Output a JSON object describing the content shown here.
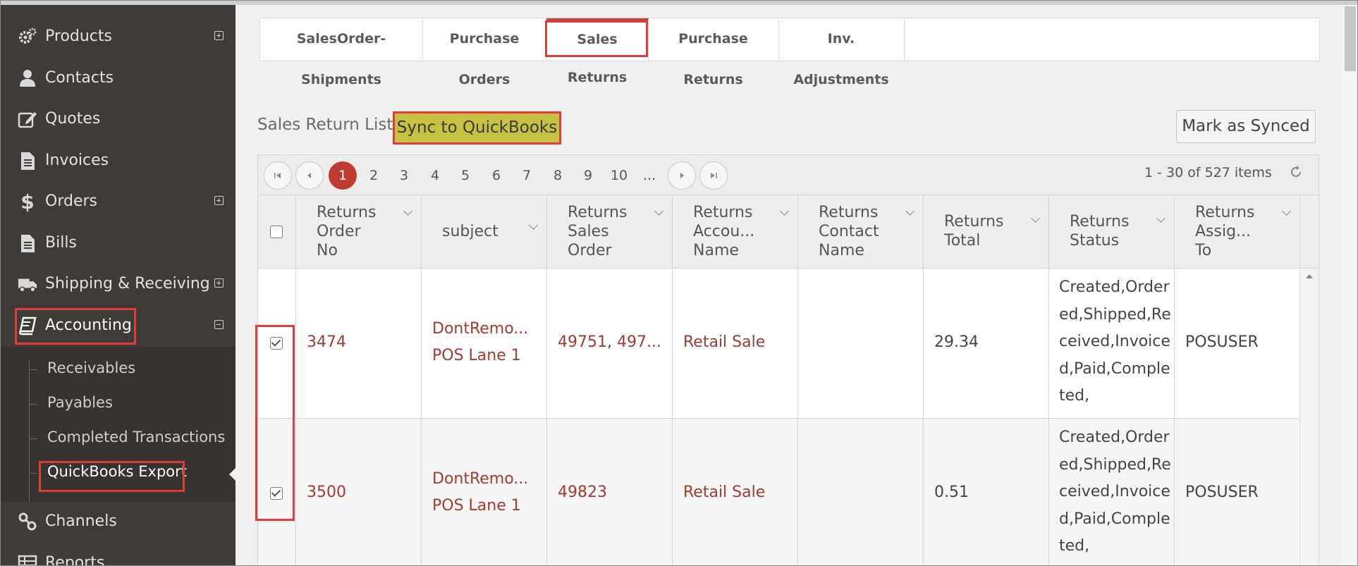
{
  "sidebar": {
    "items": [
      {
        "label": "Products",
        "icon": "gears-icon",
        "expand": "plus"
      },
      {
        "label": "Contacts",
        "icon": "user-icon",
        "expand": ""
      },
      {
        "label": "Quotes",
        "icon": "edit-icon",
        "expand": ""
      },
      {
        "label": "Invoices",
        "icon": "file-text-icon",
        "expand": ""
      },
      {
        "label": "Orders",
        "icon": "dollar-icon",
        "expand": "plus"
      },
      {
        "label": "Bills",
        "icon": "file-icon",
        "expand": ""
      },
      {
        "label": "Shipping & Receiving",
        "icon": "truck-icon",
        "expand": "plus"
      },
      {
        "label": "Accounting",
        "icon": "book-icon",
        "expand": "minus"
      },
      {
        "label": "Channels",
        "icon": "link-icon",
        "expand": ""
      },
      {
        "label": "Reports",
        "icon": "table-icon",
        "expand": ""
      }
    ],
    "accounting_sub": [
      {
        "label": "Receivables"
      },
      {
        "label": "Payables"
      },
      {
        "label": "Completed Transactions"
      },
      {
        "label": "QuickBooks Export"
      }
    ]
  },
  "tabs": [
    {
      "label": "SalesOrder-Shipments"
    },
    {
      "label": "Purchase Orders"
    },
    {
      "label": "Sales Returns"
    },
    {
      "label": "Purchase Returns"
    },
    {
      "label": "Inv. Adjustments"
    }
  ],
  "list_title": "Sales Return List",
  "sync_button": "Sync to QuickBooks",
  "mark_button": "Mark as Synced",
  "pager": {
    "pages": [
      "1",
      "2",
      "3",
      "4",
      "5",
      "6",
      "7",
      "8",
      "9",
      "10",
      "..."
    ],
    "current": "1",
    "info": "1 - 30 of 527 items"
  },
  "columns": [
    {
      "label": "Returns\nOrder\nNo"
    },
    {
      "label": "subject"
    },
    {
      "label": "Returns\nSales\nOrder"
    },
    {
      "label": "Returns\nAccou...\nName"
    },
    {
      "label": "Returns\nContact\nName"
    },
    {
      "label": "Returns\nTotal"
    },
    {
      "label": "Returns\nStatus"
    },
    {
      "label": "Returns\nAssig...\nTo"
    }
  ],
  "rows": [
    {
      "checked": true,
      "order_no": "3474",
      "subject_line1": "DontRemo...",
      "subject_line2": "POS Lane 1",
      "sales_order_a": "49751",
      "sales_order_sep": ", ",
      "sales_order_b": "497...",
      "account": "Retail Sale",
      "contact": "",
      "total": "29.34",
      "status": "Created,Ordered,Shipped,Received,Invoiced,Paid,Completed,",
      "assigned": "POSUSER"
    },
    {
      "checked": true,
      "order_no": "3500",
      "subject_line1": "DontRemo...",
      "subject_line2": "POS Lane 1",
      "sales_order_a": "49823",
      "sales_order_sep": "",
      "sales_order_b": "",
      "account": "Retail Sale",
      "contact": "",
      "total": "0.51",
      "status": "Created,Ordered,Shipped,Received,Invoiced,Paid,Completed,",
      "assigned": "POSUSER"
    }
  ],
  "colors": {
    "accent": "#bf3a30",
    "highlight": "#e03c3c",
    "sync_bg": "#c6c043",
    "sidebar_bg": "#3f3b38"
  }
}
